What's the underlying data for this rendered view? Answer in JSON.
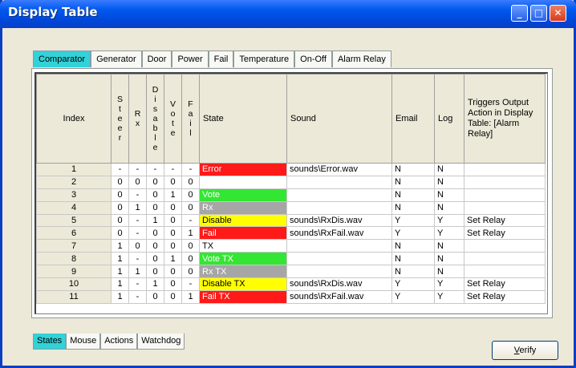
{
  "window": {
    "title": "Display Table"
  },
  "top_tabs": [
    "Comparator",
    "Generator",
    "Door",
    "Power",
    "Fail",
    "Temperature",
    "On-Off",
    "Alarm Relay"
  ],
  "bottom_tabs": [
    "States",
    "Mouse",
    "Actions",
    "Watchdog"
  ],
  "verify_label": "Verify",
  "table": {
    "headers": {
      "index": "Index",
      "steer": "S\nt\ne\ne\nr",
      "rx": "R\nx",
      "disable": "D\ni\ns\na\nb\nl\ne",
      "vote": "V\no\nt\ne",
      "fail": "F\na\ni\nl",
      "state": "State",
      "sound": "Sound",
      "email": "Email",
      "log": "Log",
      "triggers": "Triggers Output Action in Display Table: [Alarm Relay]"
    },
    "rows": [
      {
        "index": "1",
        "steer": "-",
        "rx": "-",
        "disable": "-",
        "vote": "-",
        "fail": "-",
        "state": "Error",
        "color": "red",
        "sound": "sounds\\Error.wav",
        "email": "N",
        "log": "N",
        "trigger": ""
      },
      {
        "index": "2",
        "steer": "0",
        "rx": "0",
        "disable": "0",
        "vote": "0",
        "fail": "0",
        "state": "",
        "color": "",
        "sound": "",
        "email": "N",
        "log": "N",
        "trigger": ""
      },
      {
        "index": "3",
        "steer": "0",
        "rx": "-",
        "disable": "0",
        "vote": "1",
        "fail": "0",
        "state": "Vote",
        "color": "green",
        "sound": "",
        "email": "N",
        "log": "N",
        "trigger": ""
      },
      {
        "index": "4",
        "steer": "0",
        "rx": "1",
        "disable": "0",
        "vote": "0",
        "fail": "0",
        "state": "Rx",
        "color": "gray",
        "sound": "",
        "email": "N",
        "log": "N",
        "trigger": ""
      },
      {
        "index": "5",
        "steer": "0",
        "rx": "-",
        "disable": "1",
        "vote": "0",
        "fail": "-",
        "state": "Disable",
        "color": "yellow",
        "sound": "sounds\\RxDis.wav",
        "email": "Y",
        "log": "Y",
        "trigger": "Set Relay"
      },
      {
        "index": "6",
        "steer": "0",
        "rx": "-",
        "disable": "0",
        "vote": "0",
        "fail": "1",
        "state": "Fail",
        "color": "red",
        "sound": "sounds\\RxFail.wav",
        "email": "Y",
        "log": "Y",
        "trigger": "Set Relay"
      },
      {
        "index": "7",
        "steer": "1",
        "rx": "0",
        "disable": "0",
        "vote": "0",
        "fail": "0",
        "state": "TX",
        "color": "",
        "sound": "",
        "email": "N",
        "log": "N",
        "trigger": ""
      },
      {
        "index": "8",
        "steer": "1",
        "rx": "-",
        "disable": "0",
        "vote": "1",
        "fail": "0",
        "state": "Vote TX",
        "color": "green",
        "sound": "",
        "email": "N",
        "log": "N",
        "trigger": ""
      },
      {
        "index": "9",
        "steer": "1",
        "rx": "1",
        "disable": "0",
        "vote": "0",
        "fail": "0",
        "state": "Rx TX",
        "color": "gray",
        "sound": "",
        "email": "N",
        "log": "N",
        "trigger": ""
      },
      {
        "index": "10",
        "steer": "1",
        "rx": "-",
        "disable": "1",
        "vote": "0",
        "fail": "-",
        "state": "Disable TX",
        "color": "yellow",
        "sound": "sounds\\RxDis.wav",
        "email": "Y",
        "log": "Y",
        "trigger": "Set Relay"
      },
      {
        "index": "11",
        "steer": "1",
        "rx": "-",
        "disable": "0",
        "vote": "0",
        "fail": "1",
        "state": "Fail TX",
        "color": "red",
        "sound": "sounds\\RxFail.wav",
        "email": "Y",
        "log": "Y",
        "trigger": "Set Relay"
      }
    ]
  },
  "colors": {
    "red": "#ff1a1a",
    "green": "#33e633",
    "gray": "#a6a6a6",
    "yellow": "#ffff00",
    "active_tab": "#32d2d8",
    "title_bar": "#0058ee"
  },
  "icons": {
    "minimize": "minimize-icon",
    "maximize": "maximize-icon",
    "close": "close-icon"
  }
}
